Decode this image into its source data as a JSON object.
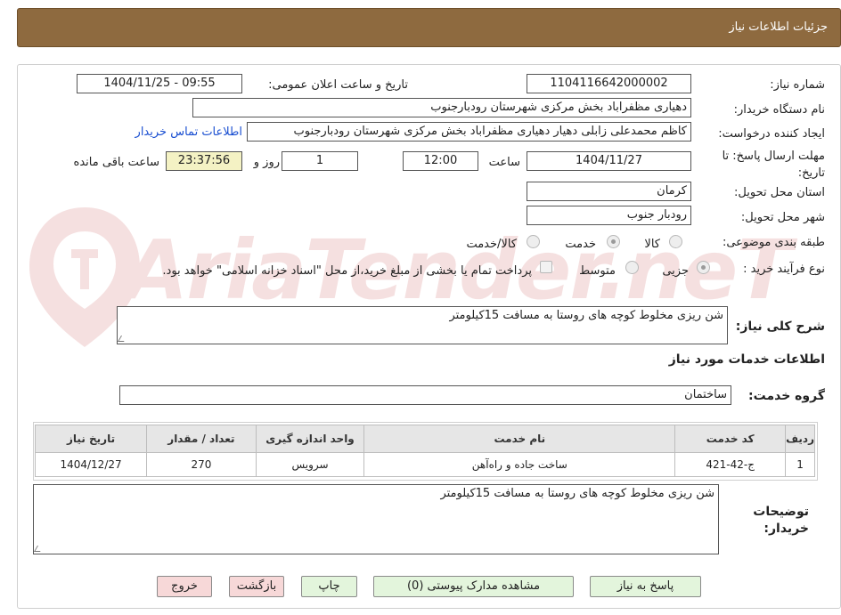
{
  "header": {
    "title": "جزئیات اطلاعات نیاز"
  },
  "form": {
    "need_number_label": "شماره نیاز:",
    "need_number": "1104116642000002",
    "announce_label": "تاریخ و ساعت اعلان عمومی:",
    "announce_value": "1404/11/25 - 09:55",
    "buyer_org_label": "نام دستگاه خریدار:",
    "buyer_org": "دهیاری مظفراباد بخش مرکزی شهرستان رودبارجنوب",
    "creator_label": "ایجاد کننده درخواست:",
    "creator": "کاظم محمدعلی زابلی دهیار دهیاری مظفراباد بخش مرکزی شهرستان رودبارجنوب",
    "contact_link": "اطلاعات تماس خریدار",
    "deadline_label": "مهلت ارسال پاسخ: تا تاریخ:",
    "deadline_date": "1404/11/27",
    "time_label": "ساعت",
    "deadline_time": "12:00",
    "days_value": "1",
    "days_label": "روز و",
    "remaining_time": "23:37:56",
    "remaining_label": "ساعت باقی مانده",
    "province_label": "استان محل تحویل:",
    "province": "کرمان",
    "city_label": "شهر محل تحویل:",
    "city": "رودبار جنوب",
    "category_label": "طبقه بندی موضوعی:",
    "category_options": [
      "کالا",
      "خدمت",
      "کالا/خدمت"
    ],
    "category_selected": "خدمت",
    "process_label": "نوع فرآیند خرید :",
    "process_options": [
      "جزیی",
      "متوسط"
    ],
    "process_selected": "جزیی",
    "payment_note": "پرداخت تمام یا بخشی از مبلغ خرید،از محل \"اسناد خزانه اسلامی\" خواهد بود.",
    "summary_label": "شرح کلی نیاز:",
    "summary": "شن ریزی مخلوط کوچه های روستا به مسافت 15کیلومتر",
    "services_heading": "اطلاعات خدمات مورد نیاز",
    "service_group_label": "گروه خدمت:",
    "service_group": "ساختمان",
    "buyer_notes_label": "توضیحات خریدار:",
    "buyer_notes": "شن ریزی مخلوط کوچه های روستا به مسافت 15کیلومتر"
  },
  "table": {
    "headers": [
      "ردیف",
      "کد خدمت",
      "نام خدمت",
      "واحد اندازه گیری",
      "تعداد / مقدار",
      "تاریخ نیاز"
    ],
    "rows": [
      [
        "1",
        "ج-42-421",
        "ساخت جاده و راه‌آهن",
        "سرویس",
        "270",
        "1404/12/27"
      ]
    ]
  },
  "buttons": {
    "reply": "پاسخ به نیاز",
    "attachments": "مشاهده مدارک پیوستی (0)",
    "print": "چاپ",
    "back": "بازگشت",
    "exit": "خروج"
  },
  "watermark": {
    "text": "AriaTender.neT"
  },
  "colors": {
    "header_bg": "#8e6a3f",
    "link": "#1a4fd1",
    "green_button": "#e3f5dc",
    "pink_button": "#f7d8d8",
    "remaining_bg": "#f4f2c4"
  }
}
